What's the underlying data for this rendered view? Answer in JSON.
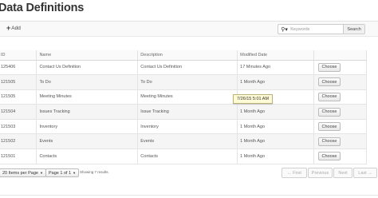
{
  "page": {
    "title": "Data Definitions"
  },
  "toolbar": {
    "add_label": "Add",
    "search_placeholder": "Keywords",
    "search_button": "Search"
  },
  "table": {
    "columns": [
      "ID",
      "Name",
      "Description",
      "Modified Date",
      ""
    ],
    "choose_label": "Choose",
    "rows": [
      {
        "id": "125406",
        "name": "Contact Us Definition",
        "description": "Contact Us Definition",
        "modified": "17 Minutes Ago"
      },
      {
        "id": "121505",
        "name": "To Do",
        "description": "To Do",
        "modified": "1 Month Ago"
      },
      {
        "id": "121505",
        "name": "Meeting Minutes",
        "description": "Meeting Minutes",
        "modified": "1 Month Ago"
      },
      {
        "id": "121504",
        "name": "Issues Tracking",
        "description": "Issue Tracking",
        "modified": "1 Month Ago"
      },
      {
        "id": "121503",
        "name": "Inventory",
        "description": "Inventory",
        "modified": "1 Month Ago"
      },
      {
        "id": "121502",
        "name": "Events",
        "description": "Events",
        "modified": "1 Month Ago"
      },
      {
        "id": "121501",
        "name": "Contacts",
        "description": "Contacts",
        "modified": "1 Month Ago"
      }
    ]
  },
  "tooltip": {
    "text": "7/26/15 5:01 AM"
  },
  "pagination": {
    "page_size": "20 Items per Page",
    "page": "Page 1 of 1",
    "results": "Showing 7 results.",
    "first": "← First",
    "previous": "Previous",
    "next": "Next",
    "last": "Last →"
  }
}
